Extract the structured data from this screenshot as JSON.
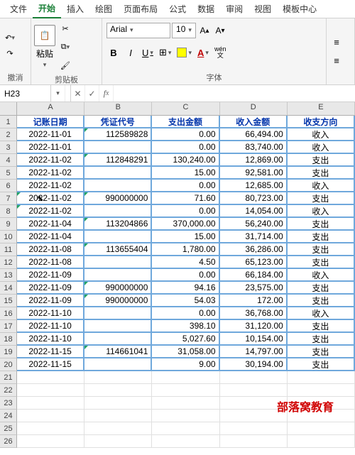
{
  "menu": [
    "文件",
    "开始",
    "插入",
    "绘图",
    "页面布局",
    "公式",
    "数据",
    "审阅",
    "视图",
    "模板中心"
  ],
  "activeMenu": 1,
  "ribbon": {
    "groups": {
      "undo": "撤消",
      "clipboard": "剪贴板",
      "paste": "粘贴",
      "font": "字体",
      "fontName": "Arial",
      "fontSize": "10",
      "wen": "wén\n文"
    }
  },
  "nameBox": "H23",
  "colHeaders": [
    "A",
    "B",
    "C",
    "D",
    "E"
  ],
  "headers": [
    "记账日期",
    "凭证代号",
    "支出金额",
    "收入金额",
    "收支方向"
  ],
  "rows": [
    {
      "date": "2022-11-01",
      "code": "112589828",
      "out": "0.00",
      "in": "66,494.00",
      "dir": "收入",
      "tri": [
        1
      ]
    },
    {
      "date": "2022-11-01",
      "code": "",
      "out": "0.00",
      "in": "83,740.00",
      "dir": "收入"
    },
    {
      "date": "2022-11-02",
      "code": "112848291",
      "out": "130,240.00",
      "in": "12,869.00",
      "dir": "支出",
      "tri": [
        1
      ]
    },
    {
      "date": "2022-11-02",
      "code": "",
      "out": "15.00",
      "in": "92,581.00",
      "dir": "支出"
    },
    {
      "date": "2022-11-02",
      "code": "",
      "out": "0.00",
      "in": "12,685.00",
      "dir": "收入"
    },
    {
      "date": "2022-11-02",
      "code": "990000000",
      "out": "71.60",
      "in": "80,723.00",
      "dir": "支出",
      "tri": [
        0,
        1
      ],
      "cursor": true
    },
    {
      "date": "2022-11-02",
      "code": "",
      "out": "0.00",
      "in": "14,054.00",
      "dir": "收入",
      "tri": [
        0
      ]
    },
    {
      "date": "2022-11-04",
      "code": "113204866",
      "out": "370,000.00",
      "in": "56,240.00",
      "dir": "支出",
      "tri": [
        1
      ]
    },
    {
      "date": "2022-11-04",
      "code": "",
      "out": "15.00",
      "in": "31,714.00",
      "dir": "支出"
    },
    {
      "date": "2022-11-08",
      "code": "113655404",
      "out": "1,780.00",
      "in": "36,286.00",
      "dir": "支出",
      "tri": [
        1
      ]
    },
    {
      "date": "2022-11-08",
      "code": "",
      "out": "4.50",
      "in": "65,123.00",
      "dir": "支出"
    },
    {
      "date": "2022-11-09",
      "code": "",
      "out": "0.00",
      "in": "66,184.00",
      "dir": "收入"
    },
    {
      "date": "2022-11-09",
      "code": "990000000",
      "out": "94.16",
      "in": "23,575.00",
      "dir": "支出",
      "tri": [
        1
      ]
    },
    {
      "date": "2022-11-09",
      "code": "990000000",
      "out": "54.03",
      "in": "172.00",
      "dir": "支出",
      "tri": [
        1
      ]
    },
    {
      "date": "2022-11-10",
      "code": "",
      "out": "0.00",
      "in": "36,768.00",
      "dir": "收入"
    },
    {
      "date": "2022-11-10",
      "code": "",
      "out": "398.10",
      "in": "31,120.00",
      "dir": "支出"
    },
    {
      "date": "2022-11-10",
      "code": "",
      "out": "5,027.60",
      "in": "10,154.00",
      "dir": "支出"
    },
    {
      "date": "2022-11-15",
      "code": "114661041",
      "out": "31,058.00",
      "in": "14,797.00",
      "dir": "支出",
      "tri": [
        1
      ]
    },
    {
      "date": "2022-11-15",
      "code": "",
      "out": "9.00",
      "in": "30,194.00",
      "dir": "支出"
    }
  ],
  "emptyRows": [
    21,
    22,
    23,
    24,
    25,
    26
  ],
  "watermark": "部落窝教育"
}
